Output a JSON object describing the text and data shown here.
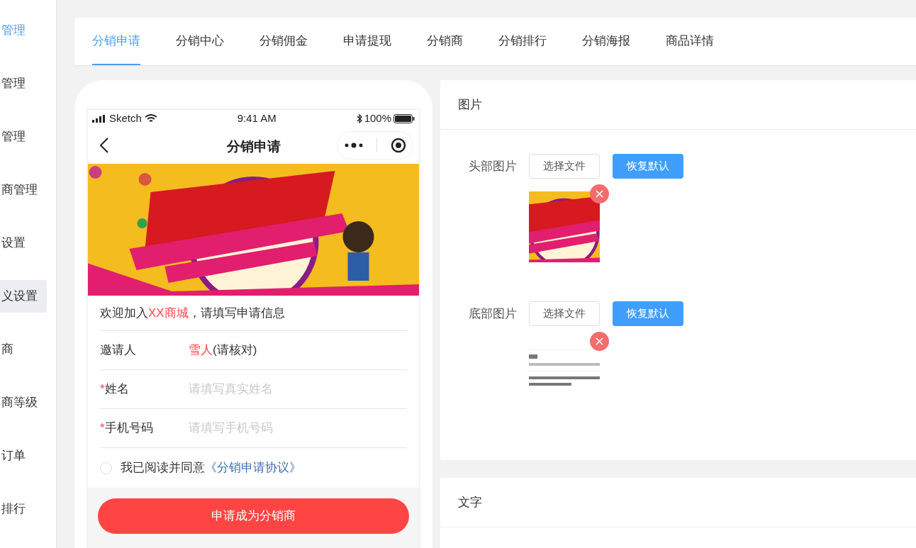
{
  "sidebar": {
    "items": [
      {
        "label": "管理",
        "selected": false,
        "highlighted": true
      },
      {
        "label": "管理",
        "selected": false,
        "highlighted": false
      },
      {
        "label": "管理",
        "selected": false,
        "highlighted": false
      },
      {
        "label": "商管理",
        "selected": false,
        "highlighted": false
      },
      {
        "label": "设置",
        "selected": false,
        "highlighted": false
      },
      {
        "label": "义设置",
        "selected": true,
        "highlighted": false
      },
      {
        "label": "商",
        "selected": false,
        "highlighted": false
      },
      {
        "label": "商等级",
        "selected": false,
        "highlighted": false
      },
      {
        "label": "订单",
        "selected": false,
        "highlighted": false
      },
      {
        "label": "排行",
        "selected": false,
        "highlighted": false
      }
    ]
  },
  "tabs": [
    {
      "label": "分销申请",
      "selected": true
    },
    {
      "label": "分销中心",
      "selected": false
    },
    {
      "label": "分销佣金",
      "selected": false
    },
    {
      "label": "申请提现",
      "selected": false
    },
    {
      "label": "分销商",
      "selected": false
    },
    {
      "label": "分销排行",
      "selected": false
    },
    {
      "label": "分销海报",
      "selected": false
    },
    {
      "label": "商品详情",
      "selected": false
    }
  ],
  "phone": {
    "status_bar": {
      "carrier": "Sketch",
      "time": "9:41 AM",
      "battery": "100%"
    },
    "nav_title": "分销申请",
    "welcome": {
      "before": "欢迎加入",
      "highlight": "XX商城",
      "after": "，请填写申请信息"
    },
    "fields": [
      {
        "kind": "static",
        "label": "邀请人",
        "value_highlight": "雪人",
        "value": "(请核对)"
      },
      {
        "kind": "input",
        "required_mark": "*",
        "label": "姓名",
        "placeholder": "请填写真实姓名"
      },
      {
        "kind": "input",
        "required_mark": "*",
        "label": "手机号码",
        "placeholder": "请填写手机号码"
      }
    ],
    "agreement": {
      "checked": false,
      "text": "我已阅读并同意",
      "link": "《分销申请协议》"
    },
    "submit": "申请成为分销商"
  },
  "image_panel": {
    "title": "图片",
    "rows": [
      {
        "label": "头部图片",
        "choose": "选择文件",
        "reset": "恢复默认",
        "kind": "banner"
      },
      {
        "label": "底部图片",
        "choose": "选择文件",
        "reset": "恢复默认",
        "kind": "document"
      }
    ]
  },
  "text_panel": {
    "title": "文字"
  }
}
